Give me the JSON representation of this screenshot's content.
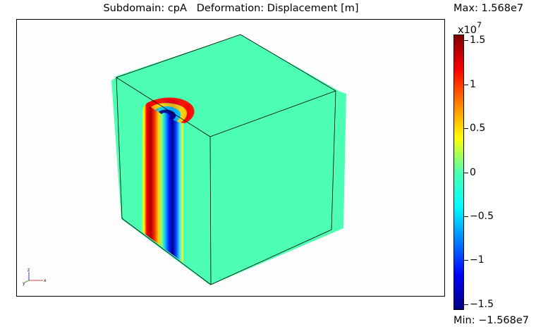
{
  "plot": {
    "title": "Subdomain: cpA   Deformation: Displacement [m]"
  },
  "colorbar": {
    "max_label": "Max: 1.568e7",
    "min_label": "Min: −1.568e7",
    "exponent_base": "x10",
    "exponent_power": "7",
    "ticks": [
      {
        "value": 1.5,
        "label": "1.5"
      },
      {
        "value": 1,
        "label": "1"
      },
      {
        "value": 0.5,
        "label": "0.5"
      },
      {
        "value": 0,
        "label": "0"
      },
      {
        "value": -0.5,
        "label": "−0.5"
      },
      {
        "value": -1,
        "label": "−1"
      },
      {
        "value": -1.5,
        "label": "−1.5"
      }
    ],
    "range": [
      -1.568,
      1.568
    ],
    "colormap": [
      "#7f0000",
      "#ff0000",
      "#ff8000",
      "#ffff00",
      "#4dffb2",
      "#00ffff",
      "#0080ff",
      "#0000ff",
      "#00007f"
    ]
  },
  "axes_triad": {
    "x": "x",
    "y": "y",
    "z": "z"
  },
  "colors": {
    "zero_surface": "#4dffb2",
    "positive_peak": "#a80000",
    "negative_peak": "#00008c"
  }
}
